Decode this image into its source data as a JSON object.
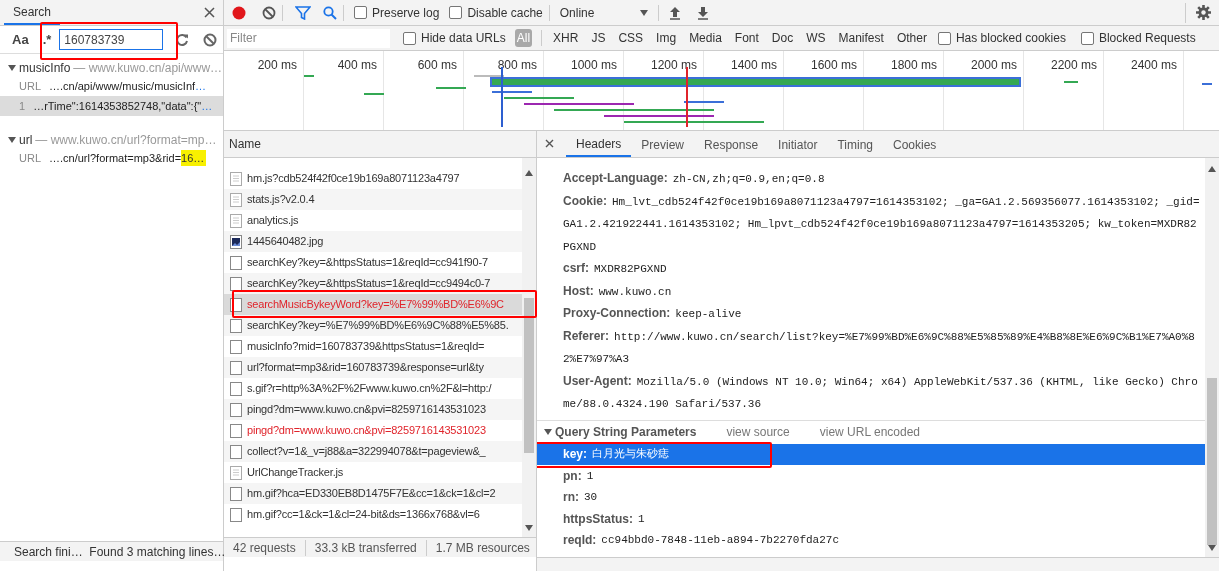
{
  "search_panel": {
    "tab": {
      "label": "Search",
      "selected": true
    },
    "case_button": "Aa",
    "regex_button": ".*",
    "query": "160783739",
    "results": [
      {
        "name": "musicInfo",
        "hint": "— www.kuwo.cn/api/www…",
        "expanded": true,
        "lines": [
          {
            "label": "URL",
            "text": "….cn/api/www/music/musicInf",
            "ellipsis": "…",
            "selected": false
          },
          {
            "label": "1",
            "text": "…rTime\":1614353852748,\"data\":{\"",
            "ellipsis": "…",
            "selected": true
          }
        ]
      },
      {
        "name": "url",
        "hint": "— www.kuwo.cn/url?format=mp…",
        "expanded": true,
        "lines": [
          {
            "label": "URL",
            "text": "….cn/url?format=mp3&rid=",
            "match": "16…",
            "selected": false
          }
        ]
      }
    ],
    "status": "Search fini…  Found 3 matching lines…"
  },
  "toolbar": {
    "recording": true,
    "filter_active": true,
    "preserve_log": {
      "label": "Preserve log",
      "checked": false
    },
    "disable_cache": {
      "label": "Disable cache",
      "checked": false
    },
    "throttling": "Online"
  },
  "filter_bar": {
    "placeholder": "Filter",
    "hide_data_urls": {
      "label": "Hide data URLs",
      "checked": false
    },
    "types": [
      {
        "label": "All",
        "selected": true
      },
      {
        "label": "XHR",
        "selected": false
      },
      {
        "label": "JS",
        "selected": false
      },
      {
        "label": "CSS",
        "selected": false
      },
      {
        "label": "Img",
        "selected": false
      },
      {
        "label": "Media",
        "selected": false
      },
      {
        "label": "Font",
        "selected": false
      },
      {
        "label": "Doc",
        "selected": false
      },
      {
        "label": "WS",
        "selected": false
      },
      {
        "label": "Manifest",
        "selected": false
      },
      {
        "label": "Other",
        "selected": false
      }
    ],
    "has_blocked_cookies": {
      "label": "Has blocked cookies",
      "checked": false
    },
    "blocked_requests": {
      "label": "Blocked Requests",
      "checked": false
    }
  },
  "overview": {
    "ticks": [
      "200 ms",
      "400 ms",
      "600 ms",
      "800 ms",
      "1000 ms",
      "1200 ms",
      "1400 ms",
      "1600 ms",
      "1800 ms",
      "2000 ms",
      "2200 ms",
      "2400 ms"
    ]
  },
  "requests": {
    "column": "Name",
    "rows": [
      {
        "name": "hm.js?cdb524f42f0ce19b169a8071123a4797",
        "kind": "script",
        "error": false,
        "selected": false
      },
      {
        "name": "stats.js?v2.0.4",
        "kind": "script",
        "error": false,
        "selected": false
      },
      {
        "name": "analytics.js",
        "kind": "script",
        "error": false,
        "selected": false
      },
      {
        "name": "1445640482.jpg",
        "kind": "image",
        "error": false,
        "selected": false
      },
      {
        "name": "searchKey?key=&httpsStatus=1&reqId=cc941f90-7",
        "kind": "other",
        "error": false,
        "selected": false
      },
      {
        "name": "searchKey?key=&httpsStatus=1&reqId=cc9494c0-7",
        "kind": "other",
        "error": false,
        "selected": false
      },
      {
        "name": "searchMusicBykeyWord?key=%E7%99%BD%E6%9C",
        "kind": "other",
        "error": true,
        "selected": true
      },
      {
        "name": "searchKey?key=%E7%99%BD%E6%9C%88%E5%85.",
        "kind": "other",
        "error": false,
        "selected": false
      },
      {
        "name": "musicInfo?mid=160783739&httpsStatus=1&reqId=",
        "kind": "other",
        "error": false,
        "selected": false
      },
      {
        "name": "url?format=mp3&rid=160783739&response=url&ty",
        "kind": "other",
        "error": false,
        "selected": false
      },
      {
        "name": "s.gif?r=http%3A%2F%2Fwww.kuwo.cn%2F&l=http:/",
        "kind": "other",
        "error": false,
        "selected": false
      },
      {
        "name": "pingd?dm=www.kuwo.cn&pvi=8259716143531023",
        "kind": "other",
        "error": false,
        "selected": false
      },
      {
        "name": "pingd?dm=www.kuwo.cn&pvi=8259716143531023",
        "kind": "other",
        "error": true,
        "selected": false
      },
      {
        "name": "collect?v=1&_v=j88&a=322994078&t=pageview&_",
        "kind": "other",
        "error": false,
        "selected": false
      },
      {
        "name": "UrlChangeTracker.js",
        "kind": "script",
        "error": false,
        "selected": false
      },
      {
        "name": "hm.gif?hca=ED330EB8D1475F7E&cc=1&ck=1&cl=2",
        "kind": "other",
        "error": false,
        "selected": false
      },
      {
        "name": "hm.gif?cc=1&ck=1&cl=24-bit&ds=1366x768&vl=6",
        "kind": "other",
        "error": false,
        "selected": false
      }
    ],
    "summary": [
      "42 requests",
      "33.3 kB transferred",
      "1.7 MB resources"
    ]
  },
  "details": {
    "tabs": [
      {
        "label": "Headers",
        "selected": true
      },
      {
        "label": "Preview",
        "selected": false
      },
      {
        "label": "Response",
        "selected": false
      },
      {
        "label": "Initiator",
        "selected": false
      },
      {
        "label": "Timing",
        "selected": false
      },
      {
        "label": "Cookies",
        "selected": false
      }
    ],
    "headers": [
      {
        "name": "Accept-Language:",
        "value": "zh-CN,zh;q=0.9,en;q=0.8"
      },
      {
        "name": "Cookie:",
        "value": "Hm_lvt_cdb524f42f0ce19b169a8071123a4797=1614353102; _ga=GA1.2.569356077.1614353102; _gid=GA1.2.421922441.1614353102; Hm_lpvt_cdb524f42f0ce19b169a8071123a4797=1614353205; kw_token=MXDR82PGXND"
      },
      {
        "name": "csrf:",
        "value": "MXDR82PGXND"
      },
      {
        "name": "Host:",
        "value": "www.kuwo.cn"
      },
      {
        "name": "Proxy-Connection:",
        "value": "keep-alive"
      },
      {
        "name": "Referer:",
        "value": "http://www.kuwo.cn/search/list?key=%E7%99%BD%E6%9C%88%E5%85%89%E4%B8%8E%E6%9C%B1%E7%A0%82%E7%97%A3"
      },
      {
        "name": "User-Agent:",
        "value": "Mozilla/5.0 (Windows NT 10.0; Win64; x64) AppleWebKit/537.36 (KHTML, like Gecko) Chrome/88.0.4324.190 Safari/537.36"
      }
    ],
    "query_section": {
      "title": "Query String Parameters",
      "expanded": true,
      "links": [
        "view source",
        "view URL encoded"
      ],
      "params": [
        {
          "name": "key:",
          "value": "白月光与朱砂痣",
          "selected": true
        },
        {
          "name": "pn:",
          "value": "1",
          "selected": false
        },
        {
          "name": "rn:",
          "value": "30",
          "selected": false
        },
        {
          "name": "httpsStatus:",
          "value": "1",
          "selected": false
        },
        {
          "name": "reqId:",
          "value": "cc94bbd0-7848-11eb-a894-7b2270fda27c",
          "selected": false
        }
      ]
    }
  }
}
